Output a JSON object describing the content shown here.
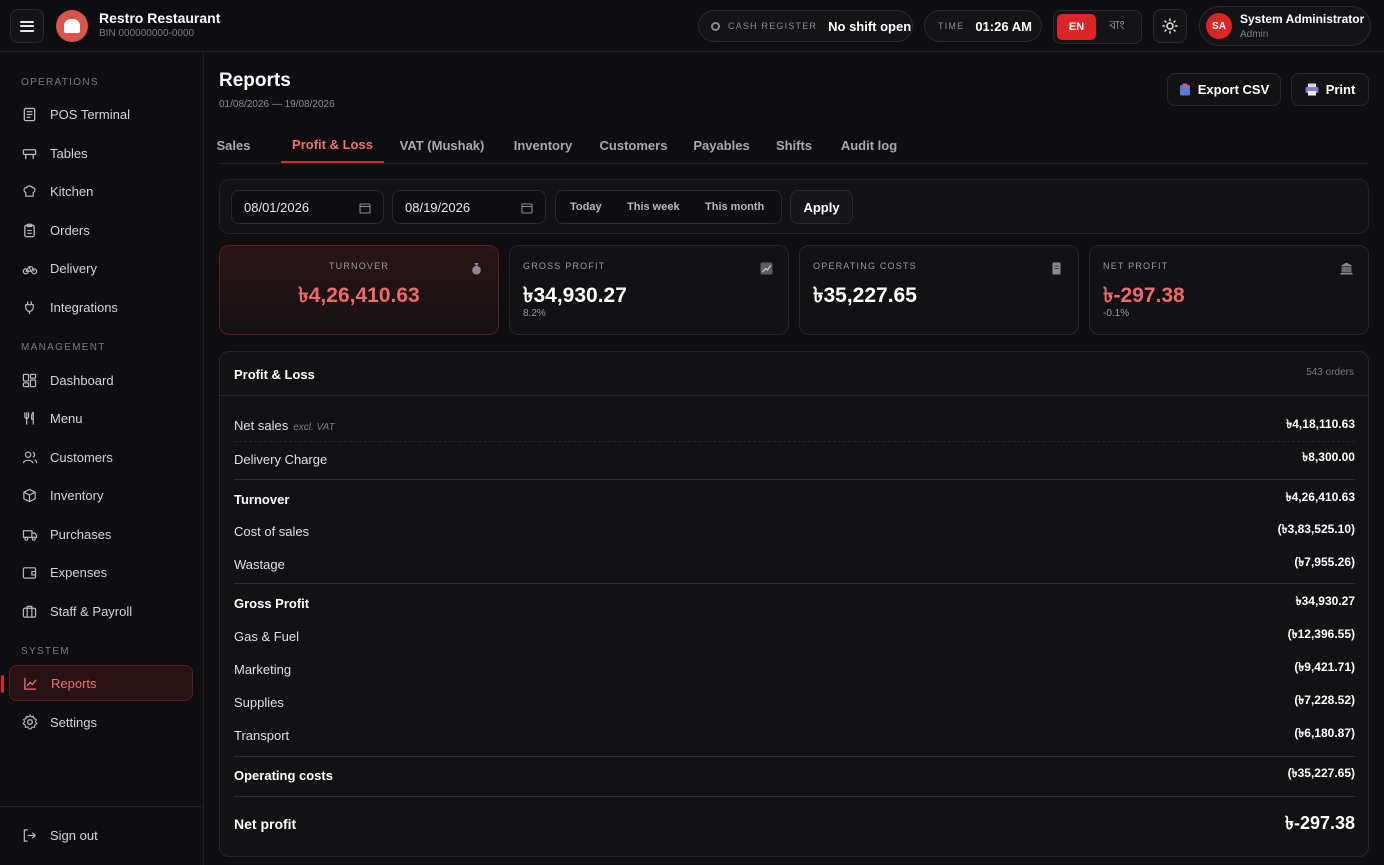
{
  "brand": {
    "name": "Restro Restaurant",
    "bin": "BIN 000000000-0000"
  },
  "header": {
    "cash_label": "CASH REGISTER",
    "cash_value": "No shift open",
    "time_label": "TIME",
    "time_value": "01:26 AM",
    "lang_en": "EN",
    "lang_bn": "বাং",
    "user_initials": "SA",
    "user_name": "System Administrator",
    "user_role": "Admin"
  },
  "sidebar": {
    "sections": {
      "operations": "OPERATIONS",
      "management": "MANAGEMENT",
      "system": "SYSTEM"
    },
    "items": [
      {
        "label": "POS Terminal",
        "icon": "document-icon"
      },
      {
        "label": "Tables",
        "icon": "table-icon"
      },
      {
        "label": "Kitchen",
        "icon": "chef-hat-icon"
      },
      {
        "label": "Orders",
        "icon": "clipboard-icon"
      },
      {
        "label": "Delivery",
        "icon": "bike-icon"
      },
      {
        "label": "Integrations",
        "icon": "plug-icon"
      },
      {
        "label": "Dashboard",
        "icon": "dashboard-icon"
      },
      {
        "label": "Menu",
        "icon": "utensils-icon"
      },
      {
        "label": "Customers",
        "icon": "users-icon"
      },
      {
        "label": "Inventory",
        "icon": "box-icon"
      },
      {
        "label": "Purchases",
        "icon": "truck-icon"
      },
      {
        "label": "Expenses",
        "icon": "wallet-icon"
      },
      {
        "label": "Staff & Payroll",
        "icon": "briefcase-icon"
      },
      {
        "label": "Reports",
        "icon": "chart-line-icon"
      },
      {
        "label": "Settings",
        "icon": "gear-icon"
      }
    ],
    "sign_out": "Sign out"
  },
  "page": {
    "title": "Reports",
    "subtitle": "01/08/2026 — 19/08/2026",
    "export_label": "Export CSV",
    "print_label": "Print"
  },
  "tabs": [
    "Sales",
    "Profit & Loss",
    "VAT (Mushak)",
    "Inventory",
    "Customers",
    "Payables",
    "Shifts",
    "Audit log"
  ],
  "active_tab": "Profit & Loss",
  "filters": {
    "from": "08/01/2026",
    "to": "08/19/2026",
    "today": "Today",
    "week": "This week",
    "month": "This month",
    "apply": "Apply"
  },
  "kpis": {
    "turnover": {
      "label": "TURNOVER",
      "value": "৳4,26,410.63"
    },
    "gross_profit": {
      "label": "GROSS PROFIT",
      "value": "৳34,930.27",
      "sub": "8.2%"
    },
    "operating_costs": {
      "label": "OPERATING COSTS",
      "value": "৳35,227.65"
    },
    "net_profit": {
      "label": "NET PROFIT",
      "value": "৳-297.38",
      "sub": "-0.1%"
    }
  },
  "pl": {
    "title": "Profit & Loss",
    "count": "543 orders",
    "net_sales_label": "Net sales",
    "net_sales_note": "excl. VAT",
    "net_sales": "৳4,18,110.63",
    "delivery_label": "Delivery Charge",
    "delivery": "৳8,300.00",
    "turnover_label": "Turnover",
    "turnover": "৳4,26,410.63",
    "cos_label": "Cost of sales",
    "cos": "(৳3,83,525.10)",
    "wastage_label": "Wastage",
    "wastage": "(৳7,955.26)",
    "gross_label": "Gross Profit",
    "gross": "৳34,930.27",
    "gas_label": "Gas & Fuel",
    "gas": "(৳12,396.55)",
    "marketing_label": "Marketing",
    "marketing": "(৳9,421.71)",
    "supplies_label": "Supplies",
    "supplies": "(৳7,228.52)",
    "transport_label": "Transport",
    "transport": "(৳6,180.87)",
    "opcost_label": "Operating costs",
    "opcost": "(৳35,227.65)",
    "net_label": "Net profit",
    "net": "৳-297.38"
  },
  "colors": {
    "accent": "#dc2626",
    "negative": "#f06a6a",
    "background": "#0e0e10",
    "surface": "#121214"
  }
}
